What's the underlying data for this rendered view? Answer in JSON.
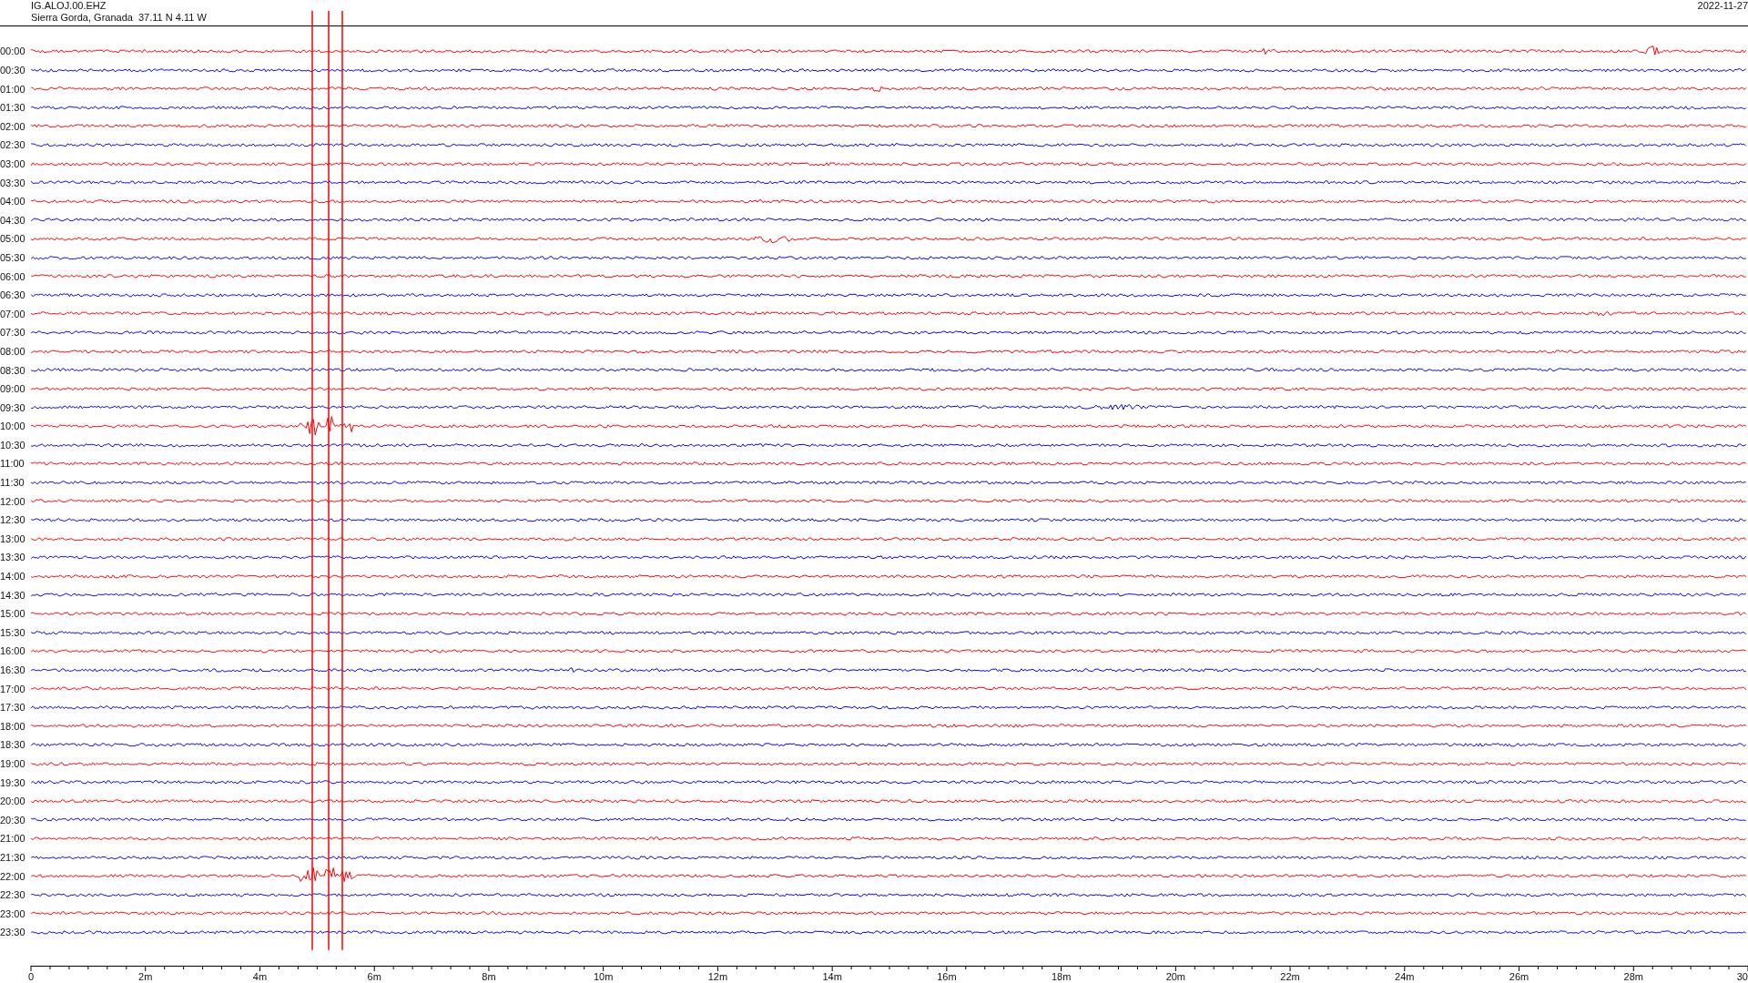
{
  "header": {
    "station": "IG.ALOJ.00.EHZ",
    "location": "Sierra Gorda, Granada  37.11 N 4.11 W",
    "date": "2022-11-27"
  },
  "rows": [
    {
      "label": "00:00",
      "color": "#ff0000"
    },
    {
      "label": "00:30",
      "color": "#0000ff"
    },
    {
      "label": "01:00",
      "color": "#ff0000"
    },
    {
      "label": "01:30",
      "color": "#0000ff"
    },
    {
      "label": "02:00",
      "color": "#ff0000"
    },
    {
      "label": "02:30",
      "color": "#0000ff"
    },
    {
      "label": "03:00",
      "color": "#ff0000"
    },
    {
      "label": "03:30",
      "color": "#0000ff"
    },
    {
      "label": "04:00",
      "color": "#ff0000"
    },
    {
      "label": "04:30",
      "color": "#0000ff"
    },
    {
      "label": "05:00",
      "color": "#ff0000"
    },
    {
      "label": "05:30",
      "color": "#0000ff"
    },
    {
      "label": "06:00",
      "color": "#ff0000"
    },
    {
      "label": "06:30",
      "color": "#0000ff"
    },
    {
      "label": "07:00",
      "color": "#ff0000"
    },
    {
      "label": "07:30",
      "color": "#0000ff"
    },
    {
      "label": "08:00",
      "color": "#ff0000"
    },
    {
      "label": "08:30",
      "color": "#0000ff"
    },
    {
      "label": "09:00",
      "color": "#ff0000"
    },
    {
      "label": "09:30",
      "color": "#0000ff"
    },
    {
      "label": "10:00",
      "color": "#ff0000"
    },
    {
      "label": "10:30",
      "color": "#0000ff"
    },
    {
      "label": "11:00",
      "color": "#ff0000"
    },
    {
      "label": "11:30",
      "color": "#0000ff"
    },
    {
      "label": "12:00",
      "color": "#ff0000"
    },
    {
      "label": "12:30",
      "color": "#0000ff"
    },
    {
      "label": "13:00",
      "color": "#ff0000"
    },
    {
      "label": "13:30",
      "color": "#0000ff"
    },
    {
      "label": "14:00",
      "color": "#ff0000"
    },
    {
      "label": "14:30",
      "color": "#0000ff"
    },
    {
      "label": "15:00",
      "color": "#ff0000"
    },
    {
      "label": "15:30",
      "color": "#0000ff"
    },
    {
      "label": "16:00",
      "color": "#ff0000"
    },
    {
      "label": "16:30",
      "color": "#0000ff"
    },
    {
      "label": "17:00",
      "color": "#ff0000"
    },
    {
      "label": "17:30",
      "color": "#0000ff"
    },
    {
      "label": "18:00",
      "color": "#ff0000"
    },
    {
      "label": "18:30",
      "color": "#0000ff"
    },
    {
      "label": "19:00",
      "color": "#ff0000"
    },
    {
      "label": "19:30",
      "color": "#0000ff"
    },
    {
      "label": "20:00",
      "color": "#ff0000"
    },
    {
      "label": "20:30",
      "color": "#0000ff"
    },
    {
      "label": "21:00",
      "color": "#ff0000"
    },
    {
      "label": "21:30",
      "color": "#0000ff"
    },
    {
      "label": "22:00",
      "color": "#ff0000"
    },
    {
      "label": "22:30",
      "color": "#0000ff"
    },
    {
      "label": "23:00",
      "color": "#ff0000"
    },
    {
      "label": "23:30",
      "color": "#0000ff"
    }
  ],
  "x_axis": {
    "ticks": [
      "0",
      "2m",
      "4m",
      "6m",
      "8m",
      "10m",
      "12m",
      "14m",
      "16m",
      "18m",
      "20m",
      "22m",
      "24m",
      "26m",
      "28m",
      "30"
    ]
  }
}
